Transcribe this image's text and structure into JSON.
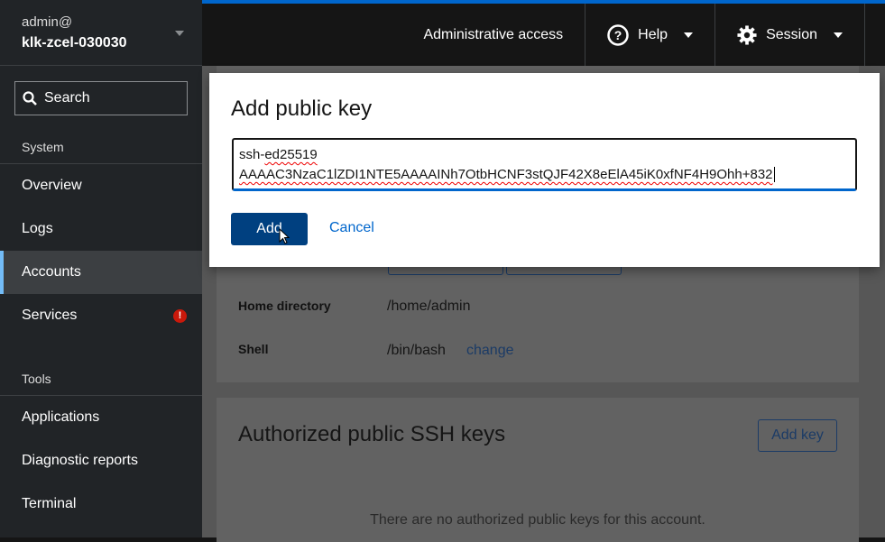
{
  "sidebar": {
    "user": "admin@",
    "host": "klk-zcel-030030",
    "search": "Search",
    "sections": [
      "System",
      "Tools"
    ],
    "system_items": [
      {
        "label": "Overview"
      },
      {
        "label": "Logs"
      },
      {
        "label": "Accounts",
        "active": true
      },
      {
        "label": "Services",
        "badge": "!"
      }
    ],
    "tool_items": [
      {
        "label": "Applications"
      },
      {
        "label": "Diagnostic reports"
      },
      {
        "label": "Terminal"
      }
    ]
  },
  "topbar": {
    "admin_access": "Administrative access",
    "help": "Help",
    "session": "Session",
    "accent": "#0066cc"
  },
  "account": {
    "home_label": "Home directory",
    "home_value": "/home/admin",
    "shell_label": "Shell",
    "shell_value": "/bin/bash",
    "change": "change"
  },
  "ssh_keys": {
    "title": "Authorized public SSH keys",
    "add_key": "Add key",
    "empty": "There are no authorized public keys for this account."
  },
  "modal": {
    "title": "Add public key",
    "key_line1": "ssh-ed25519",
    "key_line2": "AAAAC3NzaC1lZDI1NTE5AAAAINh7OtbHCNF3stQJF42X8eElA45iK0xfNF4H9Ohh+832",
    "add": "Add",
    "cancel": "Cancel"
  }
}
